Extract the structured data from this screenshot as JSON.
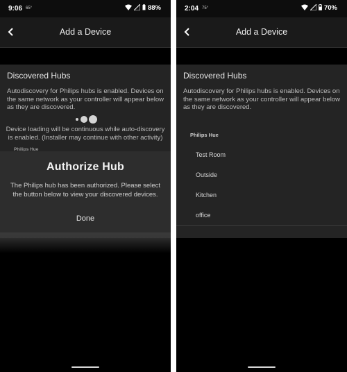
{
  "left": {
    "status": {
      "time": "9:06",
      "temp": "65°",
      "battery": "88%"
    },
    "header": {
      "title": "Add a Device"
    },
    "discovered": {
      "title": "Discovered Hubs",
      "description": "Autodiscovery for Philips hubs is enabled. Devices on the same network as your controller will appear below as they are discovered.",
      "loading_note": "Device loading will be continuous while auto-discovery is enabled. (Installer may continue with other activity)",
      "hub_label_partial": "Philips Hue"
    },
    "dialog": {
      "title": "Authorize Hub",
      "message": "The Philips hub has been authorized. Please select the button below to view your discovered devices.",
      "done_label": "Done"
    }
  },
  "right": {
    "status": {
      "time": "2:04",
      "temp": "75°",
      "battery": "70%"
    },
    "header": {
      "title": "Add a Device"
    },
    "discovered": {
      "title": "Discovered Hubs",
      "description": "Autodiscovery for Philips hubs is enabled. Devices on the same network as your controller will appear below as they are discovered.",
      "hub_label": "Philips Hue",
      "devices": [
        "Test Room",
        "Outside",
        "Kitchen",
        "office"
      ]
    }
  }
}
